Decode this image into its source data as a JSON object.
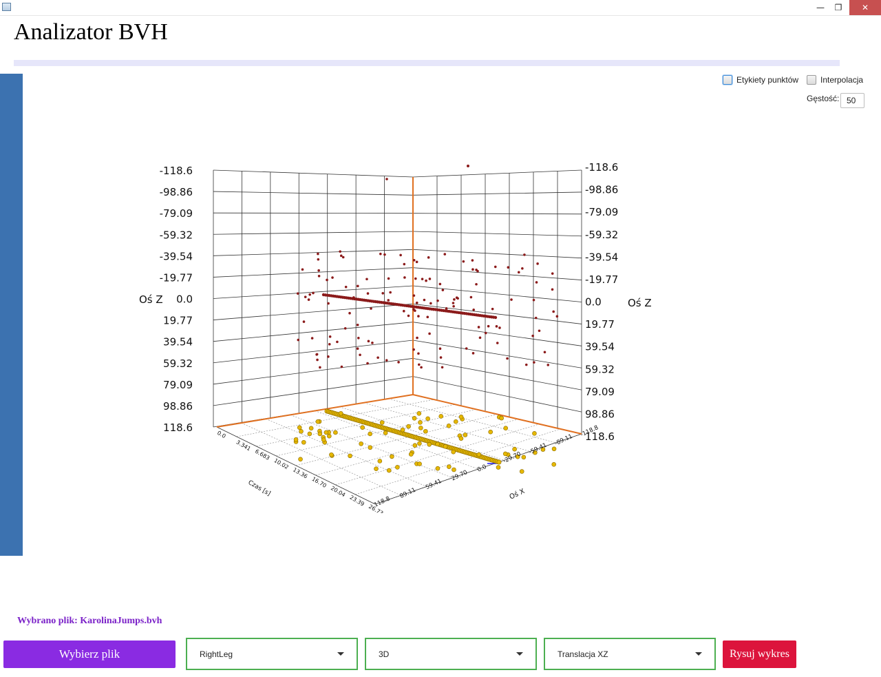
{
  "window": {
    "minimize_glyph": "—",
    "restore_glyph": "❐",
    "close_glyph": "✕"
  },
  "app": {
    "title": "Analizator BVH"
  },
  "options": {
    "point_labels": "Etykiety punktów",
    "point_labels_checked": false,
    "interpolation": "Interpolacja",
    "interpolation_checked": false,
    "density_label": "Gęstość:",
    "density_value": "50"
  },
  "chart_data": {
    "type": "scatter",
    "z_axis_label": "Oś Z",
    "x_axis_label": "Oś X",
    "t_axis_label": "Czas [s]",
    "z_ticks": [
      "-118.6",
      "-98.86",
      "-79.09",
      "-59.32",
      "-39.54",
      "-19.77",
      "0.0",
      "19.77",
      "39.54",
      "59.32",
      "79.09",
      "98.86",
      "118.6"
    ],
    "t_ticks": [
      "0.0",
      "3.341",
      "6.683",
      "10.02",
      "13.36",
      "16.70",
      "20.04",
      "23.39",
      "26.73"
    ],
    "x_ticks": [
      "118.8",
      "89.11",
      "59.41",
      "29.70",
      "0.0",
      "-29.70",
      "-59.41",
      "-89.11",
      "-118.8"
    ],
    "colors": {
      "projection": "#8b1a1a",
      "floor": "#e6b800",
      "axis": "#e07020"
    },
    "series": [
      {
        "values": "translation XZ per frame (projection on back wall)"
      }
    ]
  },
  "status": {
    "file_label": "Wybrano plik: KarolinaJumps.bvh"
  },
  "controls": {
    "choose_file": "Wybierz plik",
    "joint": "RightLeg",
    "mode": "3D",
    "channel": "Translacja XZ",
    "draw": "Rysuj wykres"
  }
}
